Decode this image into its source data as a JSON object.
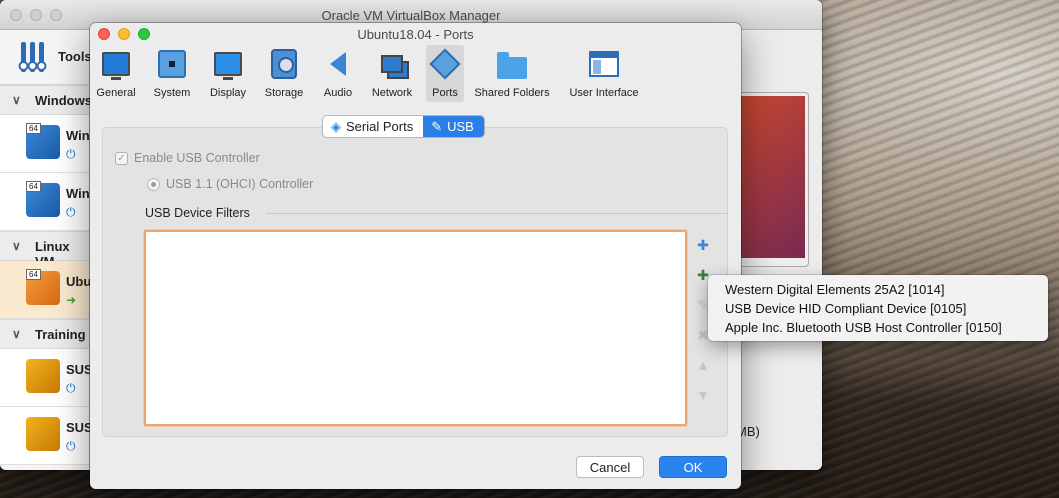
{
  "manager": {
    "title": "Oracle VM VirtualBox Manager",
    "tools_label": "Tools",
    "groups": [
      {
        "label": "Windows",
        "vms": [
          {
            "name": "Win",
            "badge": "64"
          },
          {
            "name": "Win",
            "badge": "64"
          }
        ]
      },
      {
        "label": "Linux VM",
        "vms": [
          {
            "name": "Ubu",
            "badge": "64"
          }
        ]
      },
      {
        "label": "Training",
        "vms": [
          {
            "name": "SUS"
          },
          {
            "name": "SUS"
          }
        ]
      }
    ],
    "partial_text": "MB)"
  },
  "dialog": {
    "title": "Ubuntu18.04 - Ports",
    "toolbar": [
      {
        "label": "General",
        "icon": "monitor-icon"
      },
      {
        "label": "System",
        "icon": "chip-icon"
      },
      {
        "label": "Display",
        "icon": "display-icon"
      },
      {
        "label": "Storage",
        "icon": "storage-icon"
      },
      {
        "label": "Audio",
        "icon": "audio-icon"
      },
      {
        "label": "Network",
        "icon": "network-icon"
      },
      {
        "label": "Ports",
        "icon": "ports-icon",
        "active": true
      },
      {
        "label": "Shared Folders",
        "icon": "folder-icon"
      },
      {
        "label": "User Interface",
        "icon": "user-interface-icon"
      }
    ],
    "tabs": [
      {
        "label": "Serial Ports",
        "selected": false
      },
      {
        "label": "USB",
        "selected": true
      }
    ],
    "enable_usb_label": "Enable USB Controller",
    "usb_controller_label": "USB 1.1 (OHCI) Controller",
    "filters_label": "USB Device Filters",
    "cancel_label": "Cancel",
    "ok_label": "OK"
  },
  "usb_menu": {
    "items": [
      "Western Digital Elements 25A2 [1014]",
      "USB Device HID Compliant Device [0105]",
      "Apple Inc. Bluetooth USB Host Controller [0150]"
    ]
  },
  "colors": {
    "accent": "#2b84ee",
    "focus_ring": "#f0a36a"
  }
}
